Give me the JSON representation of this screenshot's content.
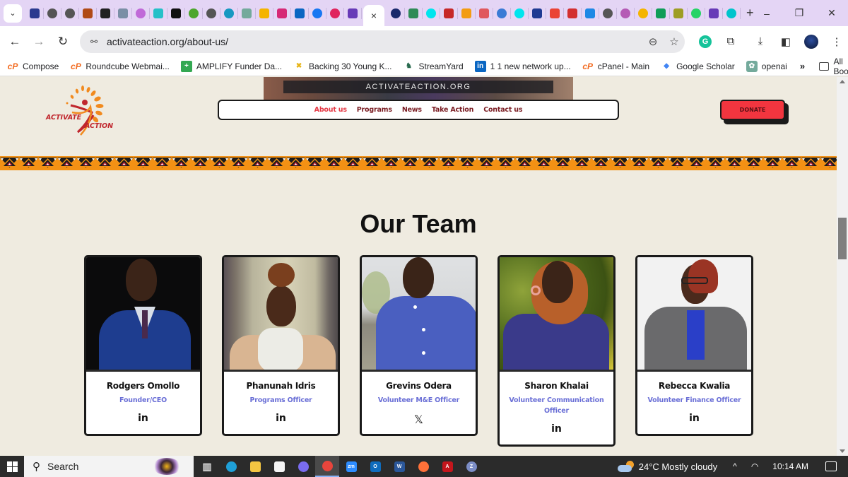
{
  "browser": {
    "tabs": {
      "favicons": [
        {
          "icon": "edc-flag-icon",
          "color": "#2b3a8f",
          "shape": "square"
        },
        {
          "icon": "globe-icon",
          "color": "#555555",
          "shape": "circle"
        },
        {
          "icon": "globe-icon",
          "color": "#555555",
          "shape": "circle"
        },
        {
          "icon": "sofa-icon",
          "color": "#b04a16",
          "shape": "square"
        },
        {
          "icon": "open-society-icon",
          "color": "#222222",
          "shape": "square"
        },
        {
          "icon": "cube-icon",
          "color": "#7b8fa6",
          "shape": "square"
        },
        {
          "icon": "swirl-icon",
          "color": "#c06ad8",
          "shape": "circle"
        },
        {
          "icon": "w-icon",
          "color": "#25c0c8",
          "shape": "square"
        },
        {
          "icon": "pill-icon",
          "color": "#111111",
          "shape": "square"
        },
        {
          "icon": "green-badge-icon",
          "color": "#4ca62c",
          "shape": "circle"
        },
        {
          "icon": "globe-icon",
          "color": "#555555",
          "shape": "circle"
        },
        {
          "icon": "salesforce-icon",
          "color": "#1798c1",
          "shape": "circle"
        },
        {
          "icon": "chatgpt-icon",
          "color": "#74aa9c",
          "shape": "square"
        },
        {
          "icon": "analytics-icon",
          "color": "#f4b400",
          "shape": "square"
        },
        {
          "icon": "instagram-icon",
          "color": "#d62976",
          "shape": "square"
        },
        {
          "icon": "linkedin-icon",
          "color": "#0a66c2",
          "shape": "square"
        },
        {
          "icon": "facebook-icon",
          "color": "#1877f2",
          "shape": "circle"
        },
        {
          "icon": "heart-icon",
          "color": "#e0245e",
          "shape": "circle"
        },
        {
          "icon": "forms-icon",
          "color": "#673ab7",
          "shape": "square"
        }
      ],
      "active_close": "×",
      "favicons_right": [
        {
          "icon": "o-icon",
          "color": "#1a2a6c",
          "shape": "circle"
        },
        {
          "icon": "feather-icon",
          "color": "#2e8b57",
          "shape": "square"
        },
        {
          "icon": "cyan-dot-icon",
          "color": "#00e5ee",
          "shape": "circle"
        },
        {
          "icon": "fi-icon",
          "color": "#c62828",
          "shape": "square"
        },
        {
          "icon": "od-icon",
          "color": "#f39c12",
          "shape": "square"
        },
        {
          "icon": "stripes-icon",
          "color": "#e0585e",
          "shape": "square"
        },
        {
          "icon": "globe-color-icon",
          "color": "#3a7bd5",
          "shape": "circle"
        },
        {
          "icon": "cyan-dot-icon",
          "color": "#00e5ee",
          "shape": "circle"
        },
        {
          "icon": "u-icon",
          "color": "#1f3a93",
          "shape": "square"
        },
        {
          "icon": "gmail-icon",
          "color": "#ea4335",
          "shape": "square"
        },
        {
          "icon": "ribbon-icon",
          "color": "#d32f2f",
          "shape": "square"
        },
        {
          "icon": "app-blue-icon",
          "color": "#1e88e5",
          "shape": "square"
        },
        {
          "icon": "globe-icon",
          "color": "#555555",
          "shape": "circle"
        },
        {
          "icon": "flower-icon",
          "color": "#b55ab5",
          "shape": "circle"
        },
        {
          "icon": "color-ring-icon",
          "color": "#f4b400",
          "shape": "circle"
        },
        {
          "icon": "google-drive-icon",
          "color": "#0f9d58",
          "shape": "square"
        },
        {
          "icon": "afp-icon",
          "color": "#9e9d24",
          "shape": "square"
        },
        {
          "icon": "whatsapp-icon",
          "color": "#25d366",
          "shape": "circle"
        },
        {
          "icon": "forms-icon",
          "color": "#673ab7",
          "shape": "square"
        },
        {
          "icon": "canva-icon",
          "color": "#00c4cc",
          "shape": "circle"
        }
      ],
      "new_tab": "+"
    },
    "window_controls": {
      "minimize": "–",
      "restore": "❐",
      "close": "✕"
    },
    "nav": {
      "back": "←",
      "forward": "→",
      "reload": "↻"
    },
    "address": {
      "url": "activateaction.org/about-us/",
      "site_info": "⚯"
    },
    "bookmarks": [
      {
        "label": "Compose",
        "icon": "cp",
        "glyph": "cP"
      },
      {
        "label": "Roundcube Webmai...",
        "icon": "cp",
        "glyph": "cP"
      },
      {
        "label": "AMPLIFY Funder Da...",
        "icon": "amp",
        "glyph": "+"
      },
      {
        "label": "Backing 30 Young K...",
        "icon": "back",
        "glyph": "✖"
      },
      {
        "label": "StreamYard",
        "icon": "sy",
        "glyph": "♞"
      },
      {
        "label": "1 1 new network up...",
        "icon": "li",
        "glyph": "in"
      },
      {
        "label": "cPanel - Main",
        "icon": "cp",
        "glyph": "cP"
      },
      {
        "label": "Google Scholar",
        "icon": "gs",
        "glyph": "◆"
      },
      {
        "label": "openai",
        "icon": "oa",
        "glyph": "✿"
      }
    ],
    "bookmarks_more": "»",
    "all_bookmarks": "All Bookmarks"
  },
  "site": {
    "brand": {
      "line1": "ACTIVATE",
      "line2": "ACTION"
    },
    "hero_caption": "ACTIVATEACTION.ORG",
    "nav": [
      {
        "label": "About us",
        "active": true
      },
      {
        "label": "Programs",
        "active": false
      },
      {
        "label": "News",
        "active": false
      },
      {
        "label": "Take Action",
        "active": false
      },
      {
        "label": "Contact us",
        "active": false
      }
    ],
    "donate_label": "DONATE",
    "colors": {
      "accent": "#e53945",
      "nav_text": "#7a1c22",
      "donate": "#f2353f",
      "role": "#6a6fd6",
      "page_bg": "#efebe0",
      "band_orange": "#f39114"
    },
    "section_title": "Our Team",
    "team": [
      {
        "name": "Rodgers Omollo",
        "role": "Founder/CEO",
        "social": "linkedin",
        "social_glyph": "in"
      },
      {
        "name": "Phanunah Idris",
        "role": "Programs Officer",
        "social": "linkedin",
        "social_glyph": "in"
      },
      {
        "name": "Grevins Odera",
        "role": "Volunteer M&E Officer",
        "social": "x",
        "social_glyph": "𝕏"
      },
      {
        "name": "Sharon Khalai",
        "role": "Volunteer Communication Officer",
        "social": "linkedin",
        "social_glyph": "in"
      },
      {
        "name": "Rebecca Kwalia",
        "role": "Volunteer Finance Officer",
        "social": "linkedin",
        "social_glyph": "in"
      }
    ]
  },
  "taskbar": {
    "search_label": "Search",
    "apps": [
      {
        "name": "task-view",
        "color": "#dddddd",
        "glyph": "▥"
      },
      {
        "name": "edge",
        "color": "#1fa0d8",
        "glyph": ""
      },
      {
        "name": "file-explorer",
        "color": "#f4c542",
        "glyph": ""
      },
      {
        "name": "microsoft-store",
        "color": "#f5f5f5",
        "glyph": ""
      },
      {
        "name": "copilot",
        "color": "#7a6cf0",
        "glyph": ""
      },
      {
        "name": "chrome",
        "color": "#e8453c",
        "glyph": "",
        "active": true
      },
      {
        "name": "zoom",
        "color": "#2d8cff",
        "glyph": "zm"
      },
      {
        "name": "outlook",
        "color": "#0f6cbd",
        "glyph": "O"
      },
      {
        "name": "word",
        "color": "#2b579a",
        "glyph": "W"
      },
      {
        "name": "firefox",
        "color": "#ff7139",
        "glyph": ""
      },
      {
        "name": "acrobat",
        "color": "#c4161c",
        "glyph": "A"
      },
      {
        "name": "zoom-client",
        "color": "#7c8ec7",
        "glyph": "Z"
      }
    ],
    "weather": "24°C  Mostly cloudy",
    "tray_chevron": "^",
    "wifi": "◠",
    "time": "10:14 AM"
  }
}
